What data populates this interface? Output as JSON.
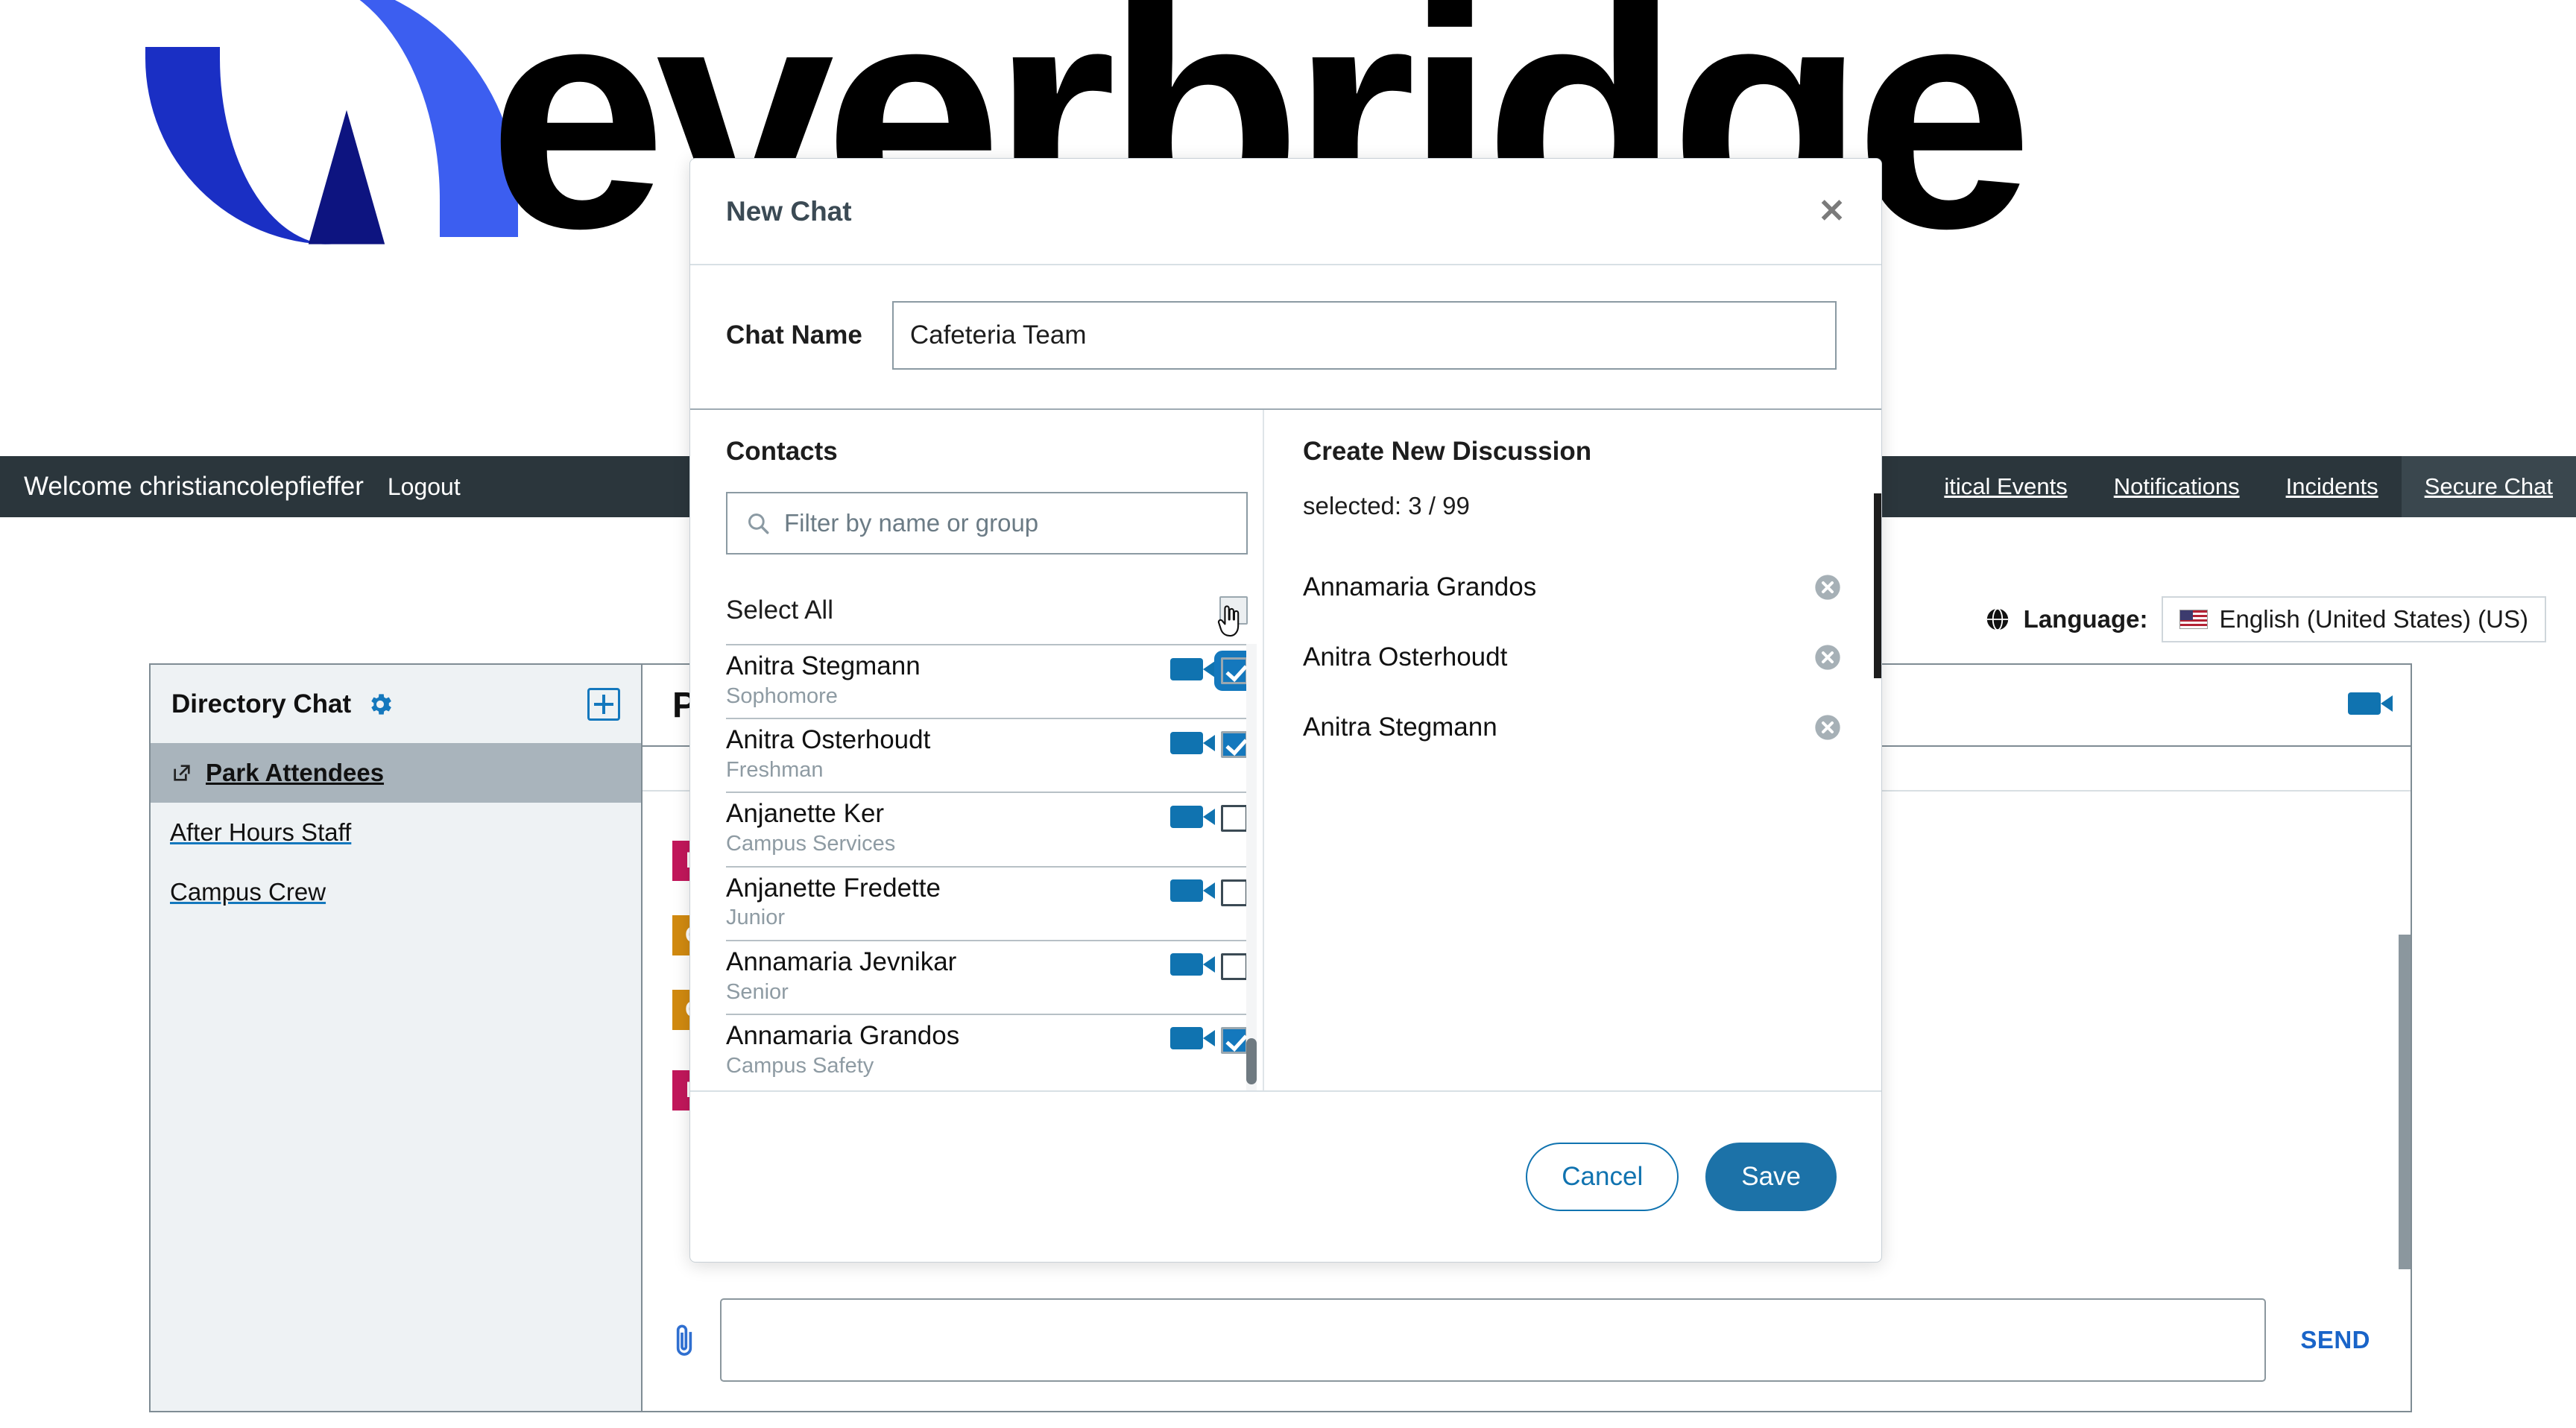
{
  "brand": {
    "name": "everbridge",
    "tm": "™"
  },
  "navbar": {
    "welcome": "Welcome christiancolepfieffer",
    "logout": "Logout",
    "links": [
      {
        "label": "itical Events",
        "active": false
      },
      {
        "label": "Notifications",
        "active": false
      },
      {
        "label": "Incidents",
        "active": false
      },
      {
        "label": "Secure Chat",
        "active": true
      }
    ]
  },
  "language": {
    "label": "Language:",
    "value": "English (United States) (US)",
    "flag_icon": "us-flag-icon",
    "globe_icon": "globe-icon"
  },
  "chat_page": {
    "sidebar": {
      "title": "Directory Chat",
      "gear_icon": "gear-icon",
      "add_icon": "add-chat-icon",
      "items": [
        {
          "label": "Park Attendees",
          "active": true,
          "icon": "external-link-icon"
        },
        {
          "label": "After Hours Staff",
          "active": false,
          "icon": ""
        },
        {
          "label": "Campus Crew",
          "active": false,
          "icon": ""
        }
      ]
    },
    "main": {
      "title": "P",
      "video_icon": "video-camera-icon",
      "messages": [
        {
          "badge": "P",
          "color": "#c2175b"
        },
        {
          "badge": "C",
          "color": "#d18a10"
        },
        {
          "badge": "C",
          "color": "#d18a10"
        },
        {
          "badge": "P",
          "color": "#c2175b"
        }
      ],
      "compose": {
        "attach_icon": "paperclip-icon",
        "input_value": "",
        "send_label": "SEND"
      }
    }
  },
  "modal": {
    "title": "New Chat",
    "close_label": "✕",
    "chat_name_label": "Chat Name",
    "chat_name_value": "Cafeteria Team",
    "contacts": {
      "heading": "Contacts",
      "filter_placeholder": "Filter by name or group",
      "filter_value": "",
      "search_icon": "search-icon",
      "select_all_label": "Select All",
      "select_all_checked": false,
      "rows": [
        {
          "name": "Anitra Stegmann",
          "sub": "Sophomore",
          "checked": true,
          "focused": true,
          "video_icon": "video-camera-icon"
        },
        {
          "name": "Anitra Osterhoudt",
          "sub": "Freshman",
          "checked": true,
          "focused": false,
          "video_icon": "video-camera-icon"
        },
        {
          "name": "Anjanette Ker",
          "sub": "Campus Services",
          "checked": false,
          "focused": false,
          "video_icon": "video-camera-icon"
        },
        {
          "name": "Anjanette Fredette",
          "sub": "Junior",
          "checked": false,
          "focused": false,
          "video_icon": "video-camera-icon"
        },
        {
          "name": "Annamaria Jevnikar",
          "sub": "Senior",
          "checked": false,
          "focused": false,
          "video_icon": "video-camera-icon"
        },
        {
          "name": "Annamaria Grandos",
          "sub": "Campus Safety",
          "checked": true,
          "focused": false,
          "video_icon": "video-camera-icon"
        }
      ]
    },
    "discussion": {
      "heading": "Create New Discussion",
      "selected_text": "selected: 3 / 99",
      "selected_count": 3,
      "total_count": 99,
      "selected": [
        {
          "name": "Annamaria Grandos",
          "remove_icon": "remove-circle-icon"
        },
        {
          "name": "Anitra Osterhoudt",
          "remove_icon": "remove-circle-icon"
        },
        {
          "name": "Anitra Stegmann",
          "remove_icon": "remove-circle-icon"
        }
      ]
    },
    "footer": {
      "cancel_label": "Cancel",
      "save_label": "Save"
    }
  },
  "colors": {
    "accent_blue": "#1478bd",
    "save_blue": "#1c72a8",
    "navbar_dark": "#2b363c",
    "sidebar_bg": "#eef2f4",
    "active_row": "#a9b4bc",
    "badge_pink": "#c2175b",
    "badge_orange": "#d18a10",
    "logo_blue_dark": "#1a2fc4",
    "logo_blue_light": "#3c5ef0"
  }
}
